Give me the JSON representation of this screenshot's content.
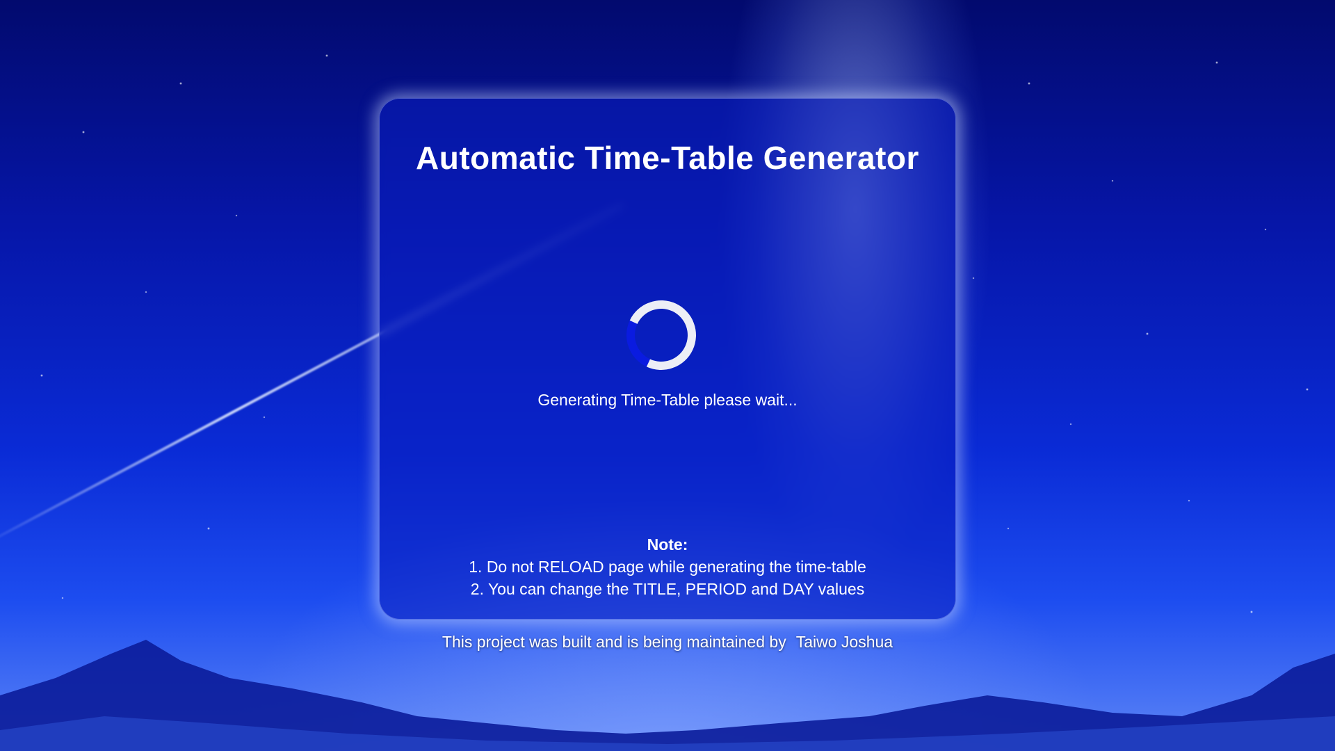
{
  "app": {
    "title": "Automatic Time-Table Generator"
  },
  "loader": {
    "message": "Generating Time-Table please wait..."
  },
  "note": {
    "heading": "Note:",
    "items": [
      "1. Do not RELOAD page while generating the time-table",
      "2. You can change the TITLE, PERIOD and DAY values"
    ]
  },
  "footer": {
    "text": "This project was built and is being maintained by",
    "author": "Taiwo Joshua"
  },
  "colors": {
    "spinner_track": "#eceef6",
    "spinner_accent": "#0a1be0",
    "card_background": "rgba(10,30,190,0.55)"
  },
  "icons": {
    "loader": "loading-spinner-icon"
  }
}
